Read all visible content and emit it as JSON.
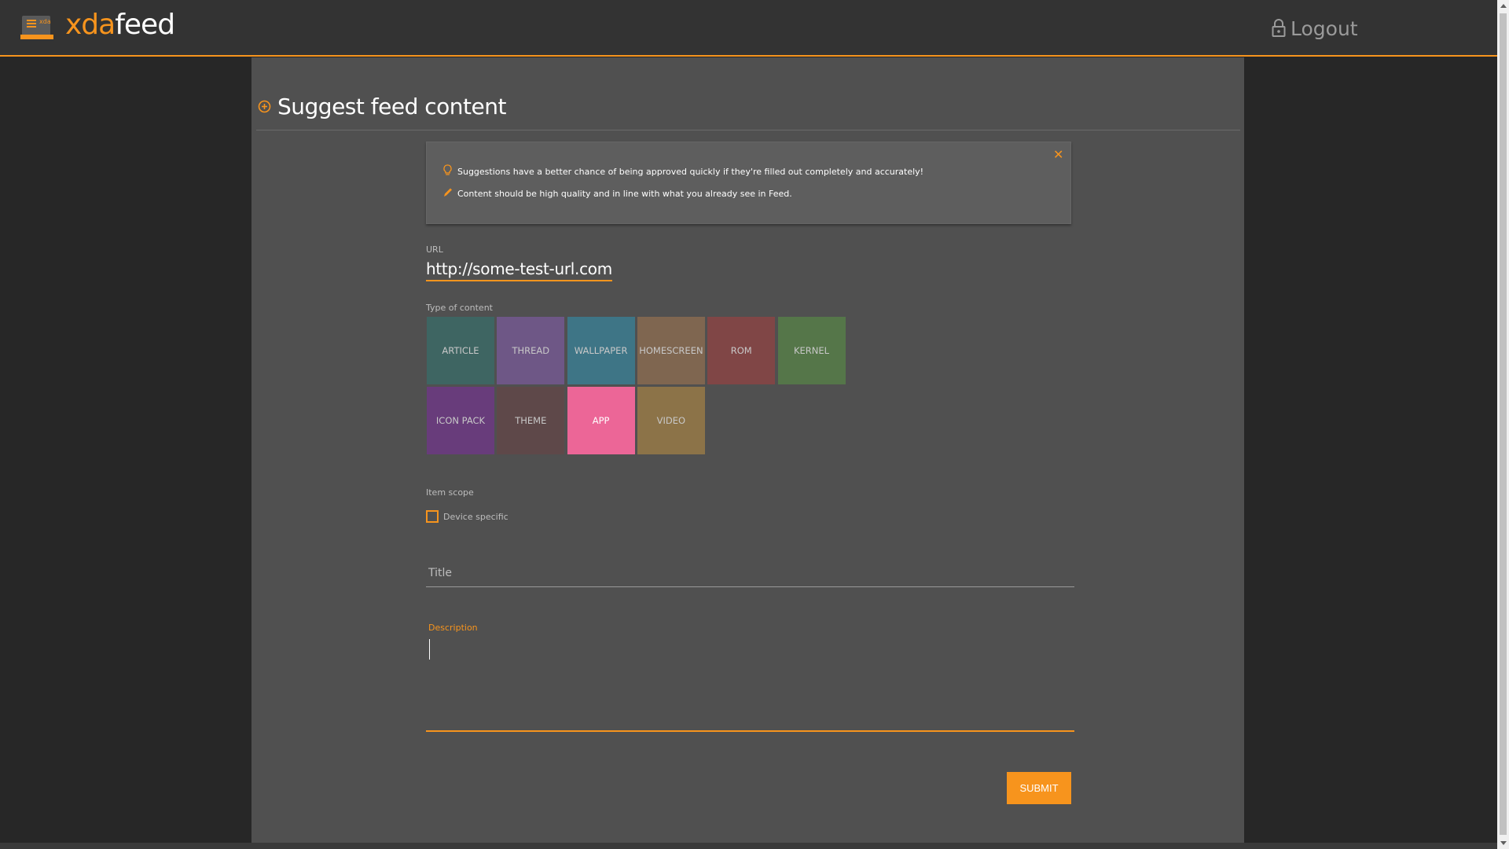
{
  "app": {
    "logo_text_part1": "xda",
    "logo_text_part2": "feed",
    "logo_badge": "xda",
    "logout_label": "Logout"
  },
  "page": {
    "title": "Suggest feed content"
  },
  "info": {
    "line1": "Suggestions have a better chance of being approved quickly if they're filled out completely and accurately!",
    "line2": "Content should be high quality and in line with what you already see in Feed."
  },
  "form": {
    "url_label": "URL",
    "url_value": "http://some-test-url.com",
    "type_label": "Type of content",
    "types": [
      {
        "label": "ARTICLE",
        "color": "#3e6562",
        "selected": false
      },
      {
        "label": "THREAD",
        "color": "#6e5786",
        "selected": false
      },
      {
        "label": "WALLPAPER",
        "color": "#3e7586",
        "selected": false
      },
      {
        "label": "HOMESCREEN",
        "color": "#7f6650",
        "selected": false
      },
      {
        "label": "ROM",
        "color": "#804646",
        "selected": false
      },
      {
        "label": "KERNEL",
        "color": "#557649",
        "selected": false
      },
      {
        "label": "ICON PACK",
        "color": "#683c7b",
        "selected": false
      },
      {
        "label": "THEME",
        "color": "#5e4849",
        "selected": false
      },
      {
        "label": "APP",
        "color": "#ec6697",
        "selected": true
      },
      {
        "label": "VIDEO",
        "color": "#8c7348",
        "selected": false
      }
    ],
    "scope_label": "Item scope",
    "device_specific_label": "Device specific",
    "device_specific_checked": false,
    "title_placeholder": "Title",
    "description_label": "Description",
    "submit_label": "SUBMIT"
  },
  "colors": {
    "accent": "#f7941d",
    "panel": "#505050",
    "header": "#333333",
    "background": "#272727"
  }
}
